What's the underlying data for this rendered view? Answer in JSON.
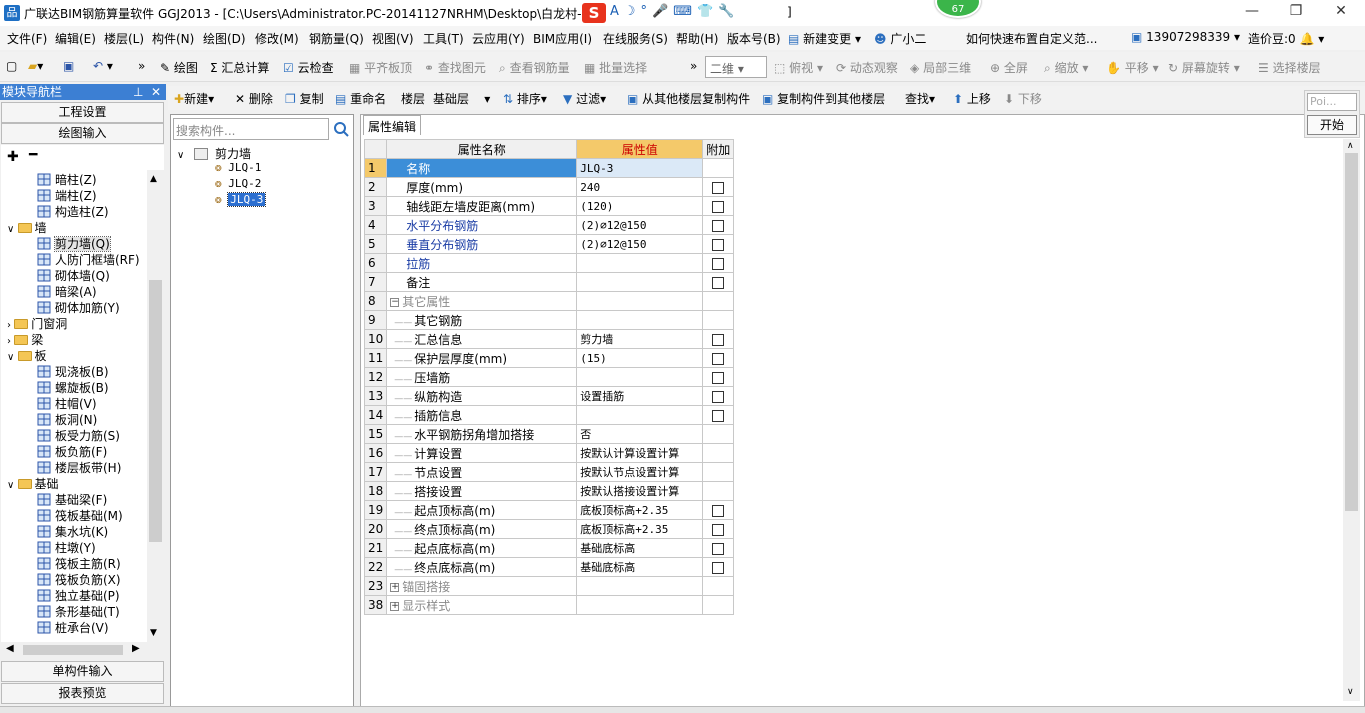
{
  "window": {
    "title": "广联达BIM钢筋算量软件 GGJ2013 - [C:\\Users\\Administrator.PC-20141127NRHM\\Desktop\\白龙村-",
    "title_tail": "]",
    "app_icon": "品",
    "ime_logo": "S",
    "badge": "67",
    "minimize": "—",
    "maximize": "❐",
    "close": "✕"
  },
  "menu": [
    "文件(F)",
    "编辑(E)",
    "楼层(L)",
    "构件(N)",
    "绘图(D)",
    "修改(M)",
    "钢筋量(Q)",
    "视图(V)",
    "工具(T)",
    "云应用(Y)",
    "BIM应用(I)",
    "在线服务(S)",
    "帮助(H)",
    "版本号(B)",
    "新建变更",
    "广小二",
    "如何快速布置自定义范...",
    "13907298339",
    "造价豆:0"
  ],
  "toolbar1": {
    "draw": "绘图",
    "sum": "汇总计算",
    "cloud_check": "云检查",
    "flush_slab": "平齐板顶",
    "find_elem": "查找图元",
    "view_rebar": "查看钢筋量",
    "batch_select": "批量选择",
    "view_mode": "二维",
    "top_view": "俯视",
    "dynamic_view": "动态观察",
    "local_3d": "局部三维",
    "fullscreen": "全屏",
    "zoom": "缩放",
    "pan": "平移",
    "screen_rotate": "屏幕旋转",
    "select_floor": "选择楼层"
  },
  "toolbar2": {
    "new": "新建",
    "delete": "删除",
    "copy": "复制",
    "rename": "重命名",
    "floor_label": "楼层",
    "floor_value": "基础层",
    "sort": "排序",
    "filter": "过滤",
    "copy_from_floor": "从其他楼层复制构件",
    "copy_to_floor": "复制构件到其他楼层",
    "find": "查找",
    "move_up": "上移",
    "move_down": "下移"
  },
  "nav": {
    "title": "模块导航栏",
    "project_settings": "工程设置",
    "drawing_input": "绘图输入",
    "single_input": "单构件输入",
    "report_preview": "报表预览",
    "tree": [
      {
        "label": "暗柱(Z)",
        "level": 2
      },
      {
        "label": "端柱(Z)",
        "level": 2
      },
      {
        "label": "构造柱(Z)",
        "level": 2
      },
      {
        "label": "墙",
        "level": 1,
        "folder": true,
        "open": true
      },
      {
        "label": "剪力墙(Q)",
        "level": 2,
        "selected": true
      },
      {
        "label": "人防门框墙(RF)",
        "level": 2
      },
      {
        "label": "砌体墙(Q)",
        "level": 2
      },
      {
        "label": "暗梁(A)",
        "level": 2
      },
      {
        "label": "砌体加筋(Y)",
        "level": 2
      },
      {
        "label": "门窗洞",
        "level": 1,
        "folder": true,
        "open": false
      },
      {
        "label": "梁",
        "level": 1,
        "folder": true,
        "open": false
      },
      {
        "label": "板",
        "level": 1,
        "folder": true,
        "open": true
      },
      {
        "label": "现浇板(B)",
        "level": 2
      },
      {
        "label": "螺旋板(B)",
        "level": 2
      },
      {
        "label": "柱帽(V)",
        "level": 2
      },
      {
        "label": "板洞(N)",
        "level": 2
      },
      {
        "label": "板受力筋(S)",
        "level": 2
      },
      {
        "label": "板负筋(F)",
        "level": 2
      },
      {
        "label": "楼层板带(H)",
        "level": 2
      },
      {
        "label": "基础",
        "level": 1,
        "folder": true,
        "open": true
      },
      {
        "label": "基础梁(F)",
        "level": 2
      },
      {
        "label": "筏板基础(M)",
        "level": 2
      },
      {
        "label": "集水坑(K)",
        "level": 2
      },
      {
        "label": "柱墩(Y)",
        "level": 2
      },
      {
        "label": "筏板主筋(R)",
        "level": 2
      },
      {
        "label": "筏板负筋(X)",
        "level": 2
      },
      {
        "label": "独立基础(P)",
        "level": 2
      },
      {
        "label": "条形基础(T)",
        "level": 2
      },
      {
        "label": "桩承台(V)",
        "level": 2
      }
    ]
  },
  "components": {
    "search_placeholder": "搜索构件...",
    "root": "剪力墙",
    "items": [
      "JLQ-1",
      "JLQ-2",
      "JLQ-3"
    ],
    "selected": "JLQ-3"
  },
  "props": {
    "tab": "属性编辑",
    "headers": [
      "属性名称",
      "属性值",
      "附加"
    ],
    "rows": [
      {
        "no": "1",
        "name": "名称",
        "value": "JLQ-3",
        "check": false,
        "style": "blue",
        "sel": true
      },
      {
        "no": "2",
        "name": "厚度(mm)",
        "value": "240",
        "check": true
      },
      {
        "no": "3",
        "name": "轴线距左墙皮距离(mm)",
        "value": "(120)",
        "check": true
      },
      {
        "no": "4",
        "name": "水平分布钢筋",
        "value": "(2)⌀12@150",
        "check": true,
        "style": "blue"
      },
      {
        "no": "5",
        "name": "垂直分布钢筋",
        "value": "(2)⌀12@150",
        "check": true,
        "style": "blue"
      },
      {
        "no": "6",
        "name": "拉筋",
        "value": "",
        "check": true,
        "style": "blue"
      },
      {
        "no": "7",
        "name": "备注",
        "value": "",
        "check": true
      },
      {
        "no": "8",
        "name": "其它属性",
        "value": "",
        "check": false,
        "style": "gray",
        "group": "−"
      },
      {
        "no": "9",
        "name": "其它钢筋",
        "value": "",
        "check": false,
        "indent": true
      },
      {
        "no": "10",
        "name": "汇总信息",
        "value": "剪力墙",
        "check": true,
        "indent": true
      },
      {
        "no": "11",
        "name": "保护层厚度(mm)",
        "value": "(15)",
        "check": true,
        "indent": true
      },
      {
        "no": "12",
        "name": "压墙筋",
        "value": "",
        "check": true,
        "indent": true
      },
      {
        "no": "13",
        "name": "纵筋构造",
        "value": "设置插筋",
        "check": true,
        "indent": true
      },
      {
        "no": "14",
        "name": "插筋信息",
        "value": "",
        "check": true,
        "indent": true
      },
      {
        "no": "15",
        "name": "水平钢筋拐角增加搭接",
        "value": "否",
        "check": false,
        "indent": true
      },
      {
        "no": "16",
        "name": "计算设置",
        "value": "按默认计算设置计算",
        "check": false,
        "indent": true
      },
      {
        "no": "17",
        "name": "节点设置",
        "value": "按默认节点设置计算",
        "check": false,
        "indent": true
      },
      {
        "no": "18",
        "name": "搭接设置",
        "value": "按默认搭接设置计算",
        "check": false,
        "indent": true
      },
      {
        "no": "19",
        "name": "起点顶标高(m)",
        "value": "底板顶标高+2.35",
        "check": true,
        "indent": true
      },
      {
        "no": "20",
        "name": "终点顶标高(m)",
        "value": "底板顶标高+2.35",
        "check": true,
        "indent": true
      },
      {
        "no": "21",
        "name": "起点底标高(m)",
        "value": "基础底标高",
        "check": true,
        "indent": true
      },
      {
        "no": "22",
        "name": "终点底标高(m)",
        "value": "基础底标高",
        "check": true,
        "indent": true
      },
      {
        "no": "23",
        "name": "锚固搭接",
        "value": "",
        "check": false,
        "style": "gray",
        "group": "+"
      },
      {
        "no": "38",
        "name": "显示样式",
        "value": "",
        "check": false,
        "style": "gray",
        "group": "+"
      }
    ]
  },
  "float_panel": {
    "poi": "Poi...",
    "start": "开始"
  },
  "colors": {
    "accent": "#3c7fd3",
    "header_value": "#f4c96a",
    "blue_text": "#1a3ca5"
  }
}
